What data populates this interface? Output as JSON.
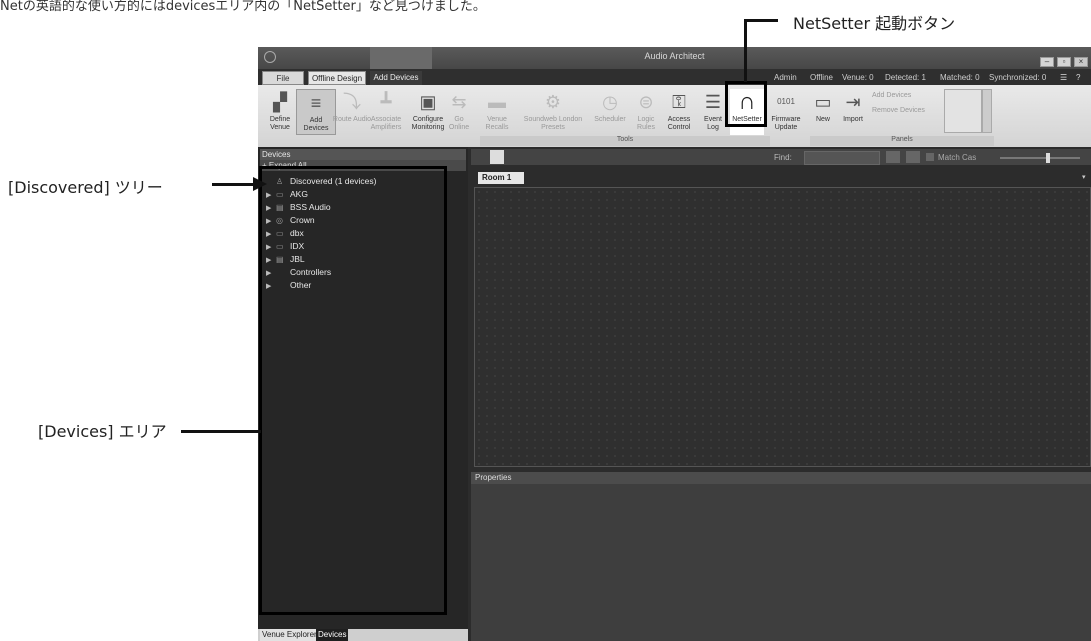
{
  "top_caption": "Netの英語的な使い方的にはdevicesエリア内の「NetSetter」など見つけました。",
  "annotations": {
    "netsetter": "NetSetter 起動ボタン",
    "discovered": "[Discovered] ツリー",
    "devices_area": "[Devices] エリア"
  },
  "window": {
    "title": "Audio Architect",
    "tabs": [
      "File",
      "Offline Design",
      "Add Devices"
    ],
    "status": {
      "admin": "Admin",
      "offline": "Offline",
      "venue": "Venue: 0",
      "detected": "Detected: 1",
      "matched": "Matched: 0",
      "synchronized": "Synchronized: 0"
    }
  },
  "ribbon": {
    "buttons": [
      {
        "label": "Define Venue",
        "icon": "define-venue-icon"
      },
      {
        "label": "Add Devices",
        "icon": "add-devices-icon"
      },
      {
        "label": "Route Audio",
        "icon": "route-audio-icon"
      },
      {
        "label": "Associate Amplifiers",
        "icon": "associate-amplifiers-icon"
      },
      {
        "label": "Configure Monitoring",
        "icon": "configure-monitoring-icon"
      },
      {
        "label": "Go Online",
        "icon": "go-online-icon"
      },
      {
        "label": "Venue Recalls",
        "icon": "venue-recalls-icon"
      },
      {
        "label": "Soundweb London Presets",
        "icon": "presets-icon"
      },
      {
        "label": "Scheduler",
        "icon": "scheduler-icon"
      },
      {
        "label": "Logic Rules",
        "icon": "logic-rules-icon"
      },
      {
        "label": "Access Control",
        "icon": "access-control-icon"
      },
      {
        "label": "Event Log",
        "icon": "event-log-icon"
      },
      {
        "label": "NetSetter",
        "icon": "netsetter-icon"
      },
      {
        "label": "Firmware Update",
        "icon": "firmware-icon"
      },
      {
        "label": "New",
        "icon": "new-panel-icon"
      },
      {
        "label": "Import",
        "icon": "import-icon"
      }
    ],
    "panel_actions": [
      "Add Devices",
      "Remove Devices"
    ],
    "group_tools": "Tools",
    "group_panels": "Panels"
  },
  "devices_panel": {
    "header": "Devices",
    "expand_all": "+ Expand All",
    "tree": [
      {
        "label": "Discovered (1 devices)",
        "icon": "network-icon"
      },
      {
        "label": "AKG",
        "icon": "akg-logo-icon"
      },
      {
        "label": "BSS Audio",
        "icon": "bss-logo-icon"
      },
      {
        "label": "Crown",
        "icon": "crown-logo-icon"
      },
      {
        "label": "dbx",
        "icon": "dbx-logo-icon"
      },
      {
        "label": "IDX",
        "icon": "idx-logo-icon"
      },
      {
        "label": "JBL",
        "icon": "jbl-logo-icon"
      },
      {
        "label": "Controllers",
        "icon": ""
      },
      {
        "label": "Other",
        "icon": ""
      }
    ],
    "bottom_tabs": [
      "Venue Explorer",
      "Devices"
    ]
  },
  "workspace": {
    "find_label": "Find:",
    "match_case": "Match Cas",
    "room_tab": "Room 1",
    "properties": "Properties"
  }
}
